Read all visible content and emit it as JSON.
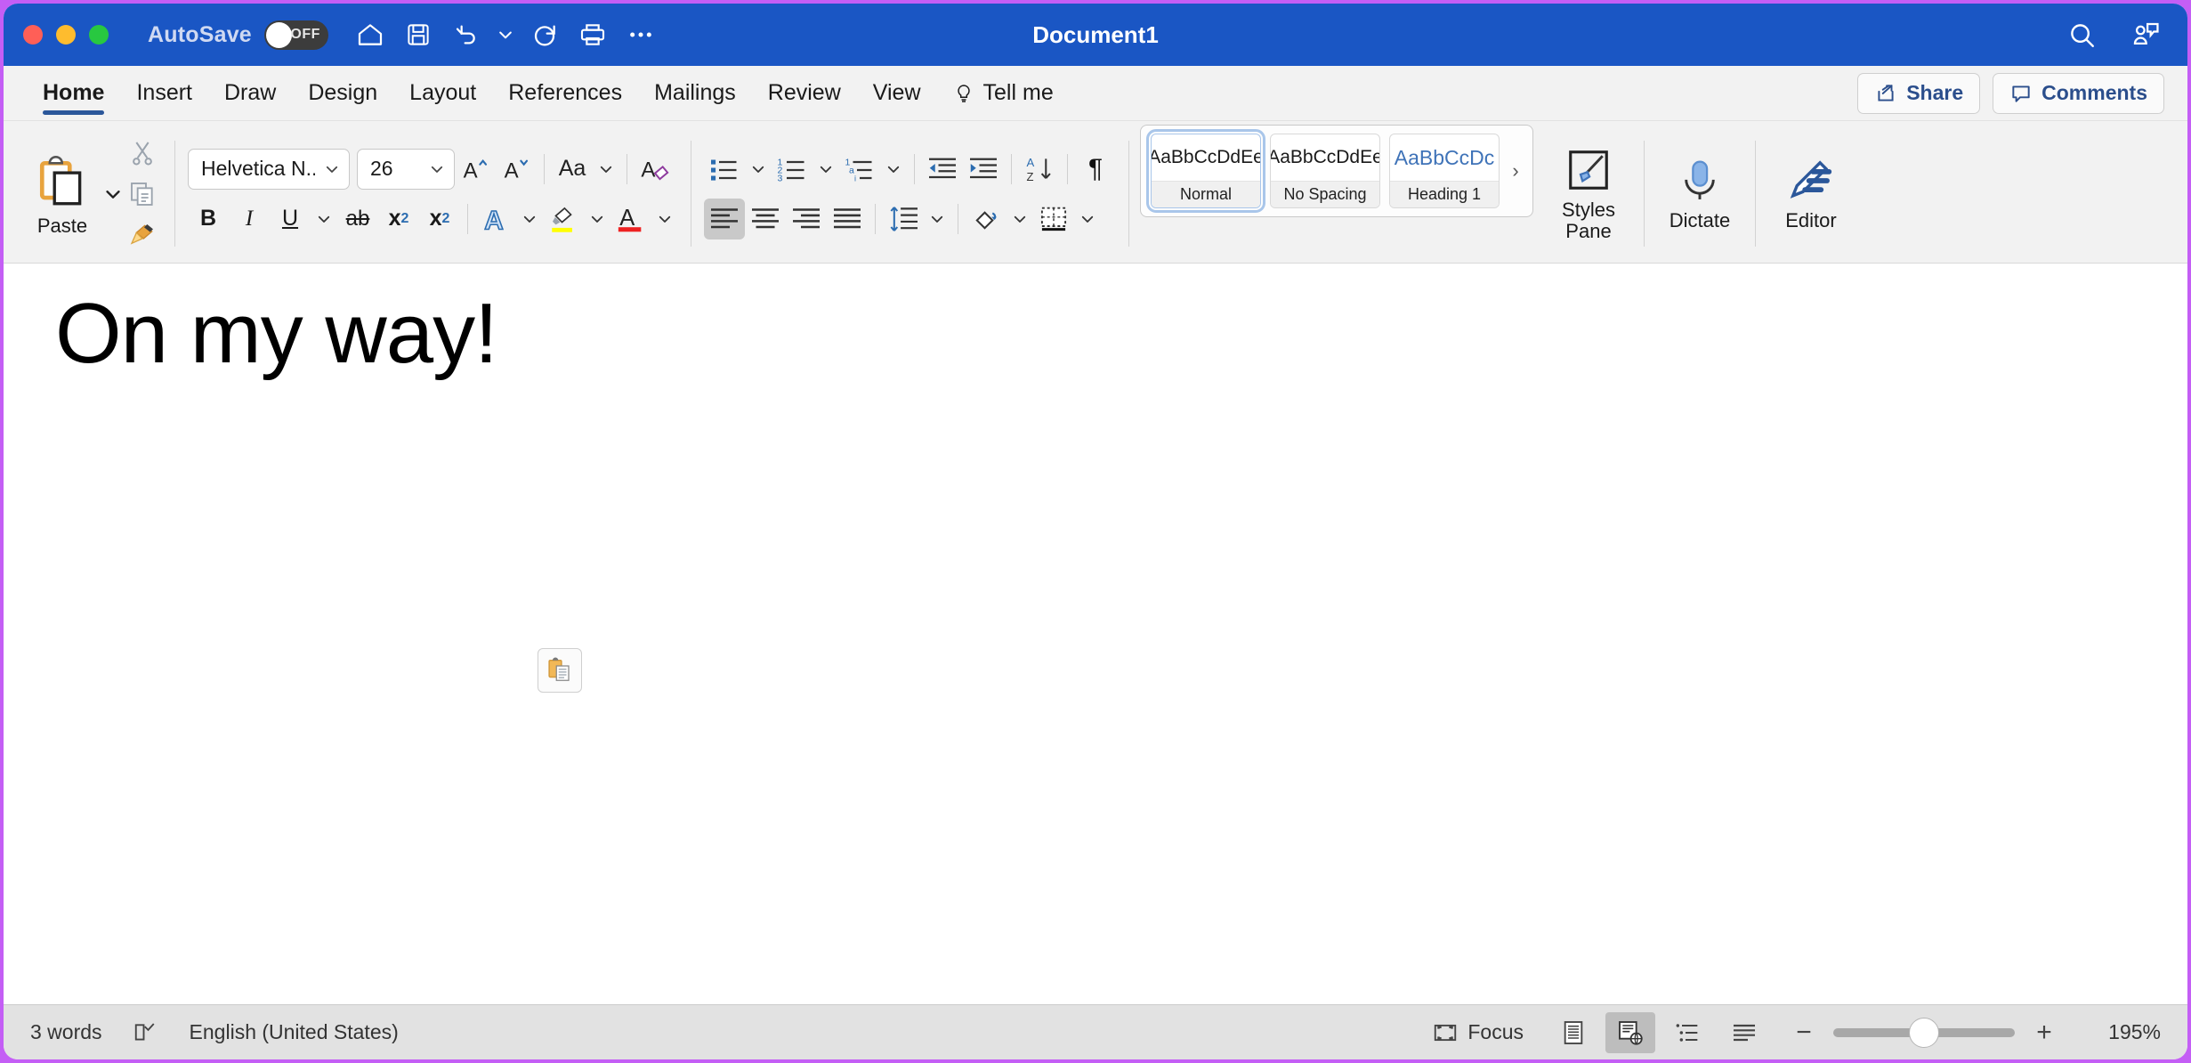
{
  "titlebar": {
    "autosave_label": "AutoSave",
    "autosave_state": "OFF",
    "document_title": "Document1",
    "quick_access": [
      {
        "name": "home-icon",
        "label": "Home"
      },
      {
        "name": "save-icon",
        "label": "Save"
      },
      {
        "name": "undo-icon",
        "label": "Undo"
      },
      {
        "name": "undo-dropdown-icon",
        "label": "Undo options"
      },
      {
        "name": "redo-icon",
        "label": "Redo"
      },
      {
        "name": "print-icon",
        "label": "Print"
      },
      {
        "name": "more-options-icon",
        "label": "More"
      }
    ],
    "right_icons": [
      {
        "name": "search-icon",
        "label": "Search"
      },
      {
        "name": "collaborators-icon",
        "label": "Collaborators"
      }
    ],
    "accent_color": "#1a56c4"
  },
  "tabs": [
    {
      "label": "Home",
      "active": true
    },
    {
      "label": "Insert",
      "active": false
    },
    {
      "label": "Draw",
      "active": false
    },
    {
      "label": "Design",
      "active": false
    },
    {
      "label": "Layout",
      "active": false
    },
    {
      "label": "References",
      "active": false
    },
    {
      "label": "Mailings",
      "active": false
    },
    {
      "label": "Review",
      "active": false
    },
    {
      "label": "View",
      "active": false
    },
    {
      "label": "Tell me",
      "active": false,
      "icon": "lightbulb-icon"
    }
  ],
  "tab_actions": {
    "share_label": "Share",
    "comments_label": "Comments",
    "link_color": "#2b4e8c"
  },
  "ribbon": {
    "clipboard": {
      "paste_label": "Paste",
      "cut_label": "Cut",
      "copy_label": "Copy",
      "format_painter_label": "Format Painter"
    },
    "font": {
      "font_name": "Helvetica N...",
      "font_size": "26",
      "grow_label": "Grow Font",
      "shrink_label": "Shrink Font",
      "change_case_label": "Aa",
      "clear_formatting_label": "Clear Formatting",
      "bold_label": "B",
      "italic_label": "I",
      "underline_label": "U",
      "strikethrough_label": "ab",
      "subscript_label": "x",
      "subscript_sub": "2",
      "superscript_label": "x",
      "superscript_sup": "2",
      "text_effects_label": "A",
      "highlight_color": "#ffff00",
      "font_color": "#ee2222"
    },
    "paragraph": {
      "bullets_label": "Bullets",
      "numbering_label": "Numbering",
      "multilevel_label": "Multilevel List",
      "decrease_indent_label": "Decrease Indent",
      "increase_indent_label": "Increase Indent",
      "sort_label": "Sort",
      "show_marks_label": "¶",
      "align_left_label": "Align Left",
      "align_center_label": "Center",
      "align_right_label": "Align Right",
      "justify_label": "Justify",
      "line_spacing_label": "Line Spacing",
      "shading_label": "Shading",
      "borders_label": "Borders"
    },
    "styles": {
      "items": [
        {
          "preview": "AaBbCcDdEe",
          "name": "Normal",
          "active": true
        },
        {
          "preview": "AaBbCcDdEe",
          "name": "No Spacing",
          "active": false
        },
        {
          "preview": "AaBbCcDc",
          "name": "Heading 1",
          "active": false,
          "heading": true
        }
      ],
      "more_arrow": "›",
      "pane_label_line1": "Styles",
      "pane_label_line2": "Pane"
    },
    "dictate_label": "Dictate",
    "editor_label": "Editor"
  },
  "document": {
    "body_text": "On my way!",
    "paste_options_label": "Paste Options"
  },
  "statusbar": {
    "word_count": "3 words",
    "proofing_label": "Proofing",
    "language": "English (United States)",
    "focus_label": "Focus",
    "views": [
      {
        "name": "print-layout-view",
        "selected": false
      },
      {
        "name": "web-layout-view",
        "selected": true
      },
      {
        "name": "outline-view",
        "selected": false
      },
      {
        "name": "draft-view",
        "selected": false
      }
    ],
    "zoom_out_label": "−",
    "zoom_in_label": "+",
    "zoom_level": "195%"
  }
}
